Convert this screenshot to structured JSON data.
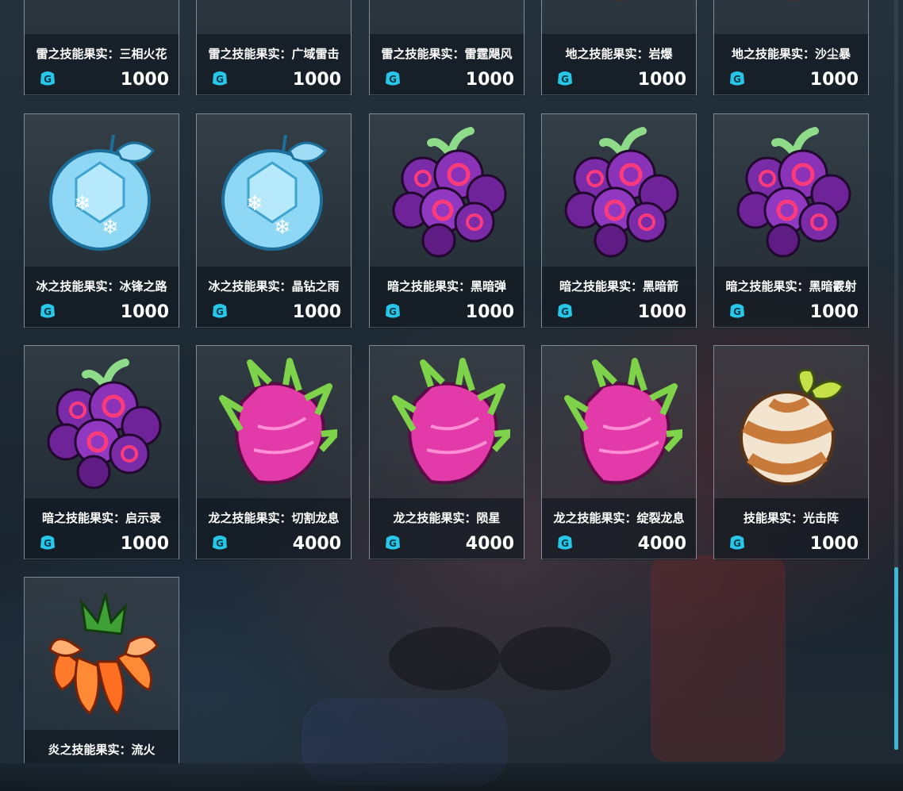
{
  "currency_icon": "gold-g-coin-icon",
  "items": [
    {
      "name": "雷之技能果实：三相火花",
      "price": "1000",
      "fruit": "thunder-fruit"
    },
    {
      "name": "雷之技能果实：广域雷击",
      "price": "1000",
      "fruit": "thunder-fruit"
    },
    {
      "name": "雷之技能果实：雷霆飓风",
      "price": "1000",
      "fruit": "thunder-fruit"
    },
    {
      "name": "地之技能果实：岩爆",
      "price": "1000",
      "fruit": "earth-fruit"
    },
    {
      "name": "地之技能果实：沙尘暴",
      "price": "1000",
      "fruit": "earth-fruit"
    },
    {
      "name": "冰之技能果实：冰锋之路",
      "price": "1000",
      "fruit": "ice-fruit"
    },
    {
      "name": "冰之技能果实：晶钻之雨",
      "price": "1000",
      "fruit": "ice-fruit"
    },
    {
      "name": "暗之技能果实：黑暗弹",
      "price": "1000",
      "fruit": "dark-fruit"
    },
    {
      "name": "暗之技能果实：黑暗箭",
      "price": "1000",
      "fruit": "dark-fruit"
    },
    {
      "name": "暗之技能果实：黑暗霰射",
      "price": "1000",
      "fruit": "dark-fruit"
    },
    {
      "name": "暗之技能果实：启示录",
      "price": "1000",
      "fruit": "dark-fruit"
    },
    {
      "name": "龙之技能果实：切割龙息",
      "price": "4000",
      "fruit": "dragon-fruit"
    },
    {
      "name": "龙之技能果实：陨星",
      "price": "4000",
      "fruit": "dragon-fruit"
    },
    {
      "name": "龙之技能果实：绽裂龙息",
      "price": "4000",
      "fruit": "dragon-fruit"
    },
    {
      "name": "技能果实：光击阵",
      "price": "1000",
      "fruit": "neutral-fruit"
    },
    {
      "name": "炎之技能果实：流火",
      "price": "",
      "fruit": "fire-fruit"
    }
  ]
}
